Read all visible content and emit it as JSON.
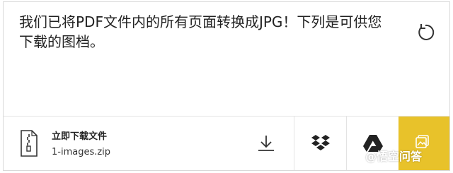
{
  "message": "我们已将PDF文件内的所有页面转换成JPG！下列是可供您下载的图档。",
  "download": {
    "title": "立即下载文件",
    "filename": "1-images.zip"
  },
  "icons": {
    "file": "zip-file-icon",
    "reset": "reset-icon",
    "download": "download-icon",
    "dropbox": "dropbox-icon",
    "gdrive": "google-drive-icon",
    "more": "image-icon"
  },
  "watermark": "@悟空问答",
  "colors": {
    "accent": "#e8c22a",
    "text": "#222222",
    "border": "#d9d9d9"
  }
}
